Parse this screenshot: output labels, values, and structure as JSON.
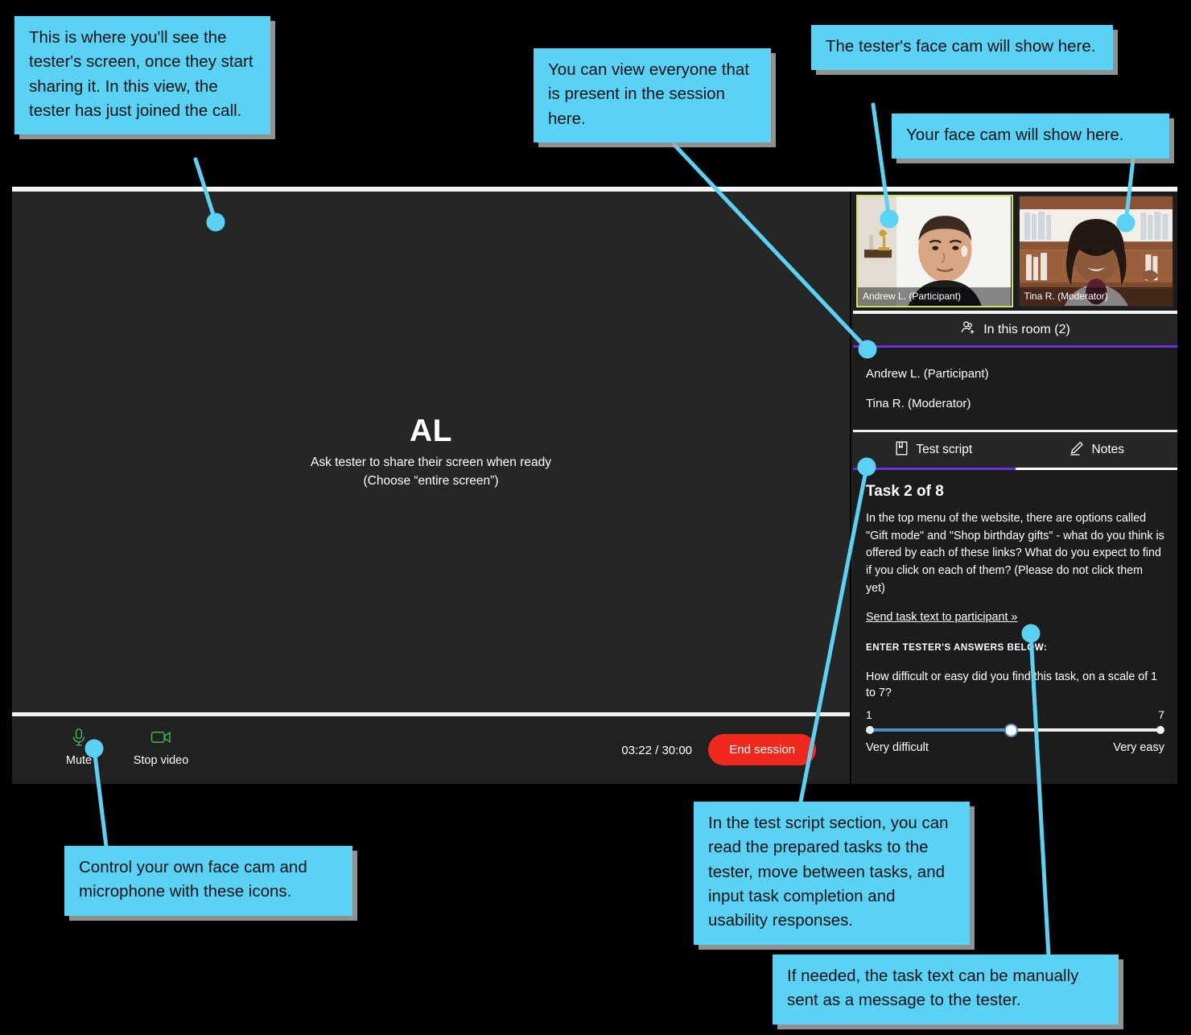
{
  "app": {
    "main": {
      "initials": "AL",
      "hint_line1": "Ask tester to share their screen when ready",
      "hint_line2": "(Choose “entire screen”)"
    },
    "controls": {
      "mute_label": "Mute",
      "mute_icon": "microphone-icon",
      "video_label": "Stop video",
      "video_icon": "camera-icon",
      "timer": "03:22 / 30:00",
      "end_session_label": "End session",
      "end_session_color": "#f0281e"
    },
    "thumbnails": [
      {
        "name": "Andrew L. (Participant)",
        "active": true
      },
      {
        "name": "Tina R. (Moderator)",
        "active": false
      }
    ],
    "room": {
      "header": "In this room (2)",
      "header_icon": "people-add-icon",
      "accent_color": "#6c2ee0",
      "people": [
        "Andrew L. (Participant)",
        "Tina R. (Moderator)"
      ]
    },
    "tabs": [
      {
        "label": "Test script",
        "icon": "document-icon",
        "active": true
      },
      {
        "label": "Notes",
        "icon": "pencil-icon",
        "active": false
      }
    ],
    "script": {
      "task_title": "Task 2 of 8",
      "task_body": "In the top menu of the website, there are options called \"Gift mode\" and \"Shop birthday gifts\" - what do you think is offered by each of these links? What do you expect to find if you click on each of them? (Please do not click them yet)",
      "send_link": "Send task text to participant »",
      "answers_label": "ENTER TESTER'S ANSWERS BELOW:",
      "question": "How difficult or easy did you find this task, on a scale of 1 to 7?",
      "scale_min": "1",
      "scale_max": "7",
      "scale_min_label": "Very difficult",
      "scale_max_label": "Very easy",
      "slider_value": 4,
      "slider_fill_color": "#4f8ecb"
    }
  },
  "callouts": [
    {
      "id": "screen-share",
      "text": "This is where you'll see the tester's screen, once they start sharing it. In this view, the tester has just joined the call."
    },
    {
      "id": "participants",
      "text": "You can view everyone that is present in the session here."
    },
    {
      "id": "tester-cam",
      "text": "The tester's face cam will show here."
    },
    {
      "id": "your-cam",
      "text": "Your face cam will show here."
    },
    {
      "id": "controls",
      "text": "Control your own face cam and microphone with these icons."
    },
    {
      "id": "test-script",
      "text": "In the test script section, you can read the prepared tasks to the tester, move between tasks, and input task completion and usability responses."
    },
    {
      "id": "send-task",
      "text": "If needed, the task text can be manually sent as a message to the tester."
    }
  ],
  "callout_color": "#5ad2f4"
}
